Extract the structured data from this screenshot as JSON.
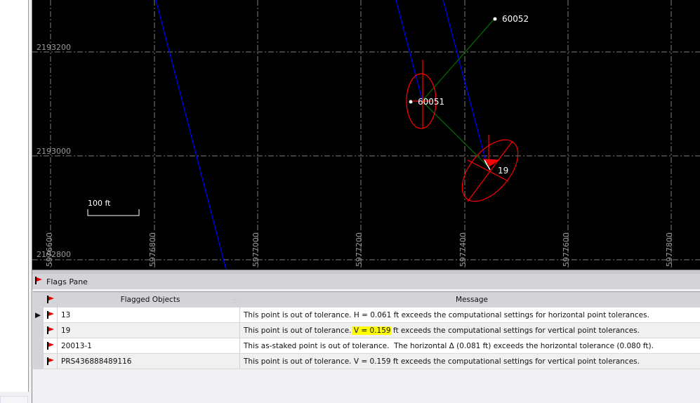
{
  "map": {
    "x_ticks": [
      "5976600",
      "5976800",
      "5977000",
      "5977200",
      "5977400",
      "5977600",
      "5977800"
    ],
    "y_ticks": [
      "2193200",
      "2193000",
      "2192800"
    ],
    "scale_label": "100 ft",
    "point_labels": [
      "60052",
      "60051",
      "19"
    ],
    "colors": {
      "background": "#000000",
      "grid": "#808080",
      "alignment": "#0000ff",
      "link": "#008000",
      "error_ellipse": "#ff0000"
    }
  },
  "pane": {
    "title": "Flags Pane",
    "flag_icon": "red-flag-icon"
  },
  "table": {
    "columns": [
      "Flagged Objects",
      "Message"
    ],
    "rows": [
      {
        "object": "13",
        "message": "This point is out of tolerance. H = 0.061 ft exceeds the computational settings for horizontal point tolerances.",
        "selected": true
      },
      {
        "object": "19",
        "message_pre": "This point is out of tolerance.",
        "message_hl": " V = 0.159",
        "message_post": " ft exceeds the computational settings for vertical point tolerances."
      },
      {
        "object": "20013-1",
        "message": "This as-staked point is out of tolerance.  The horizontal Δ (0.081 ft) exceeds the horizontal tolerance (0.080 ft)."
      },
      {
        "object": "PRS436888489116",
        "message": "This point is out of tolerance. V = 0.159 ft exceeds the computational settings for vertical point tolerances."
      }
    ]
  }
}
